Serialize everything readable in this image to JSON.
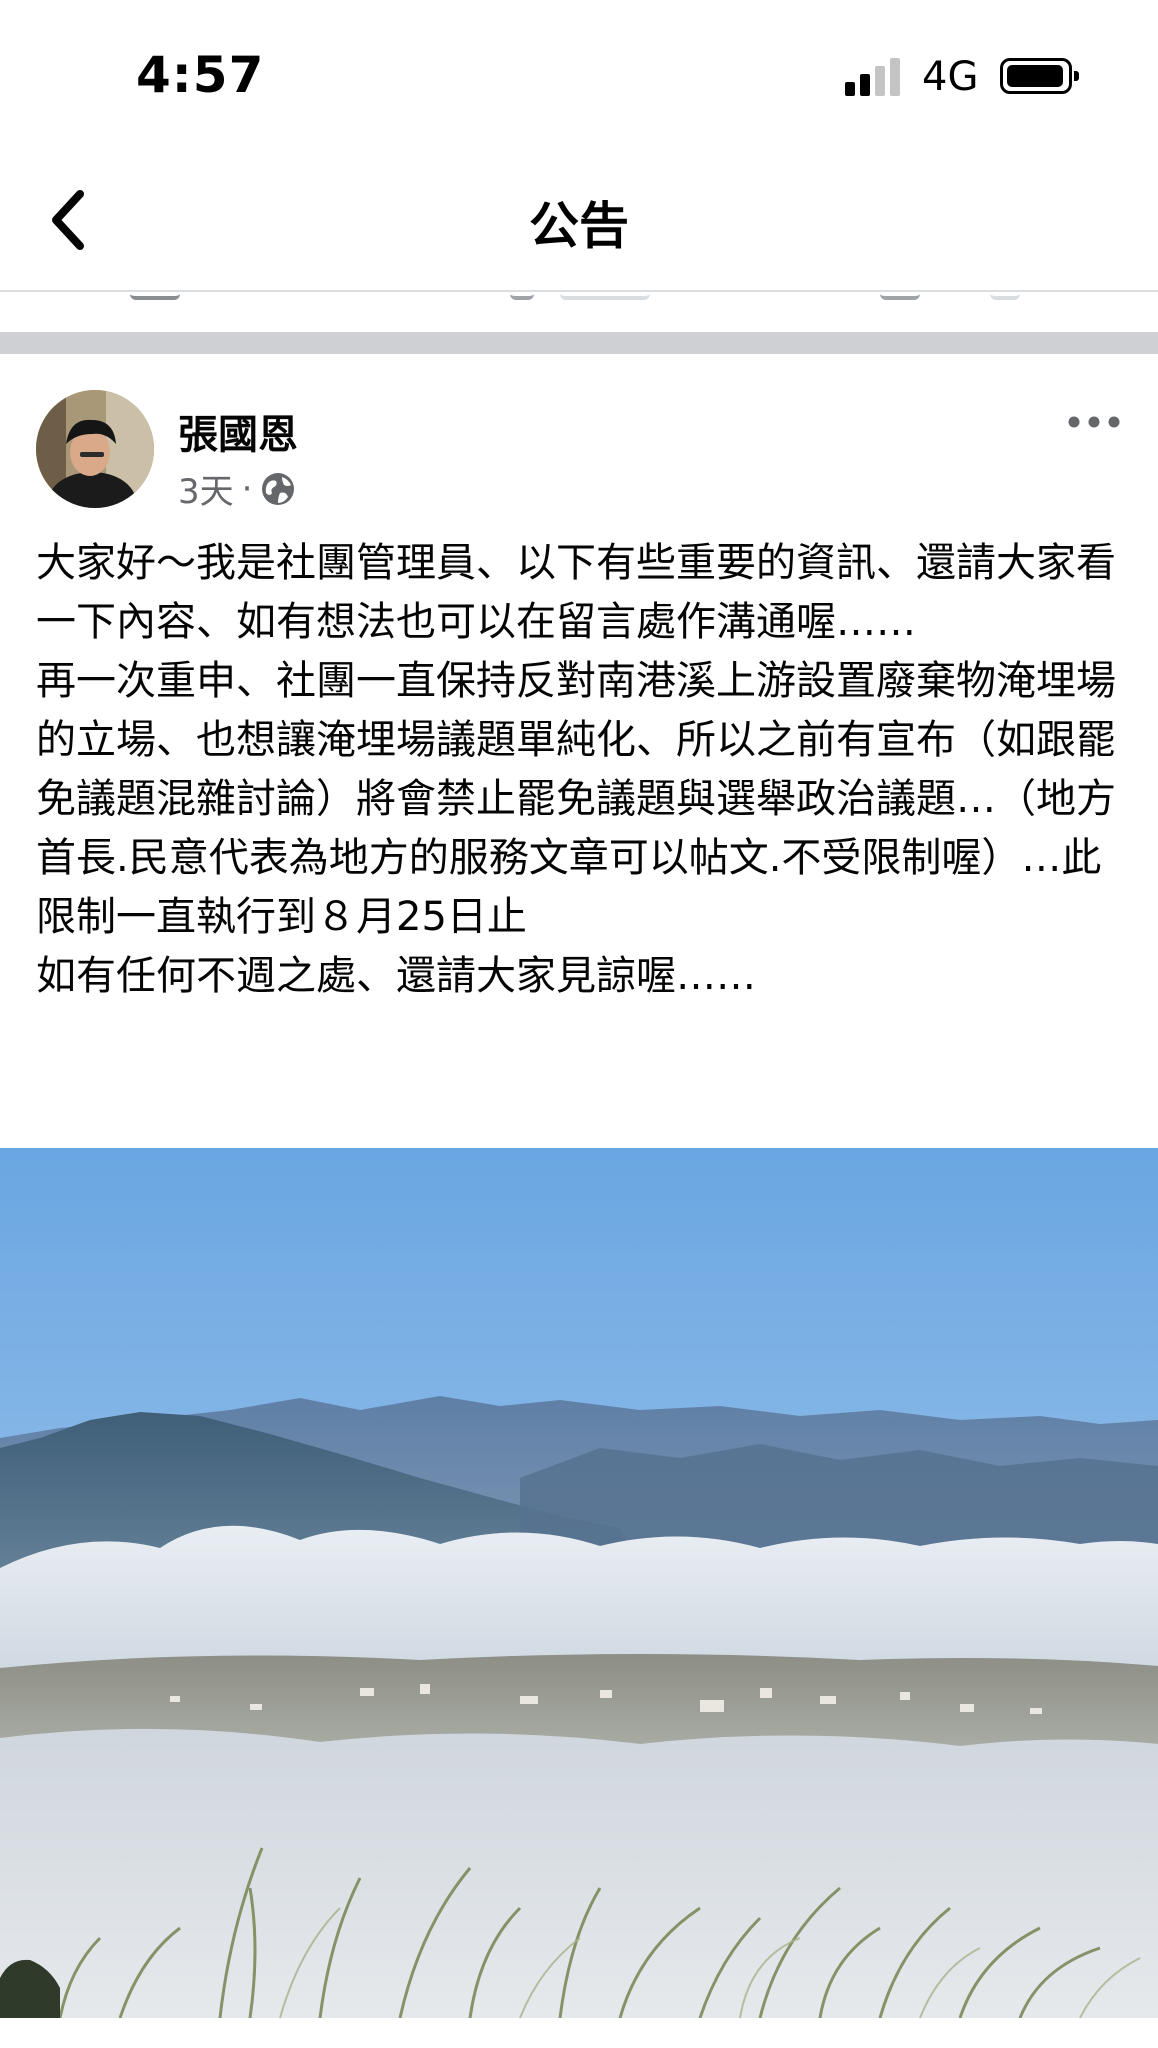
{
  "status_bar": {
    "time": "4:57",
    "network": "4G",
    "signal_bars_active": 2,
    "signal_bars_total": 4,
    "battery_icon": "battery-full-icon"
  },
  "nav": {
    "title": "公告",
    "back_icon": "chevron-left-icon"
  },
  "post": {
    "author": "張國恩",
    "time_ago": "3天",
    "separator": "·",
    "audience_icon": "globe-icon",
    "more_icon": "more-horizontal-icon",
    "body": "大家好～我是社團管理員、以下有些重要的資訊、還請大家看一下內容、如有想法也可以在留言處作溝通喔……\n再一次重申、社團一直保持反對南港溪上游設置廢棄物淹埋場的立場、也想讓淹埋場議題單純化、所以之前有宣布（如跟罷免議題混雜討論）將會禁止罷免議題與選舉政治議題…（地方首長.民意代表為地方的服務文章可以帖文.不受限制喔）…此限制一直執行到８月25日止\n如有任何不週之處、還請大家見諒喔……"
  },
  "colors": {
    "text_primary": "#050505",
    "text_secondary": "#65676b",
    "separator": "#ced0d4",
    "sky_top": "#6fa8e0",
    "sky_bottom": "#b9d6ef"
  }
}
